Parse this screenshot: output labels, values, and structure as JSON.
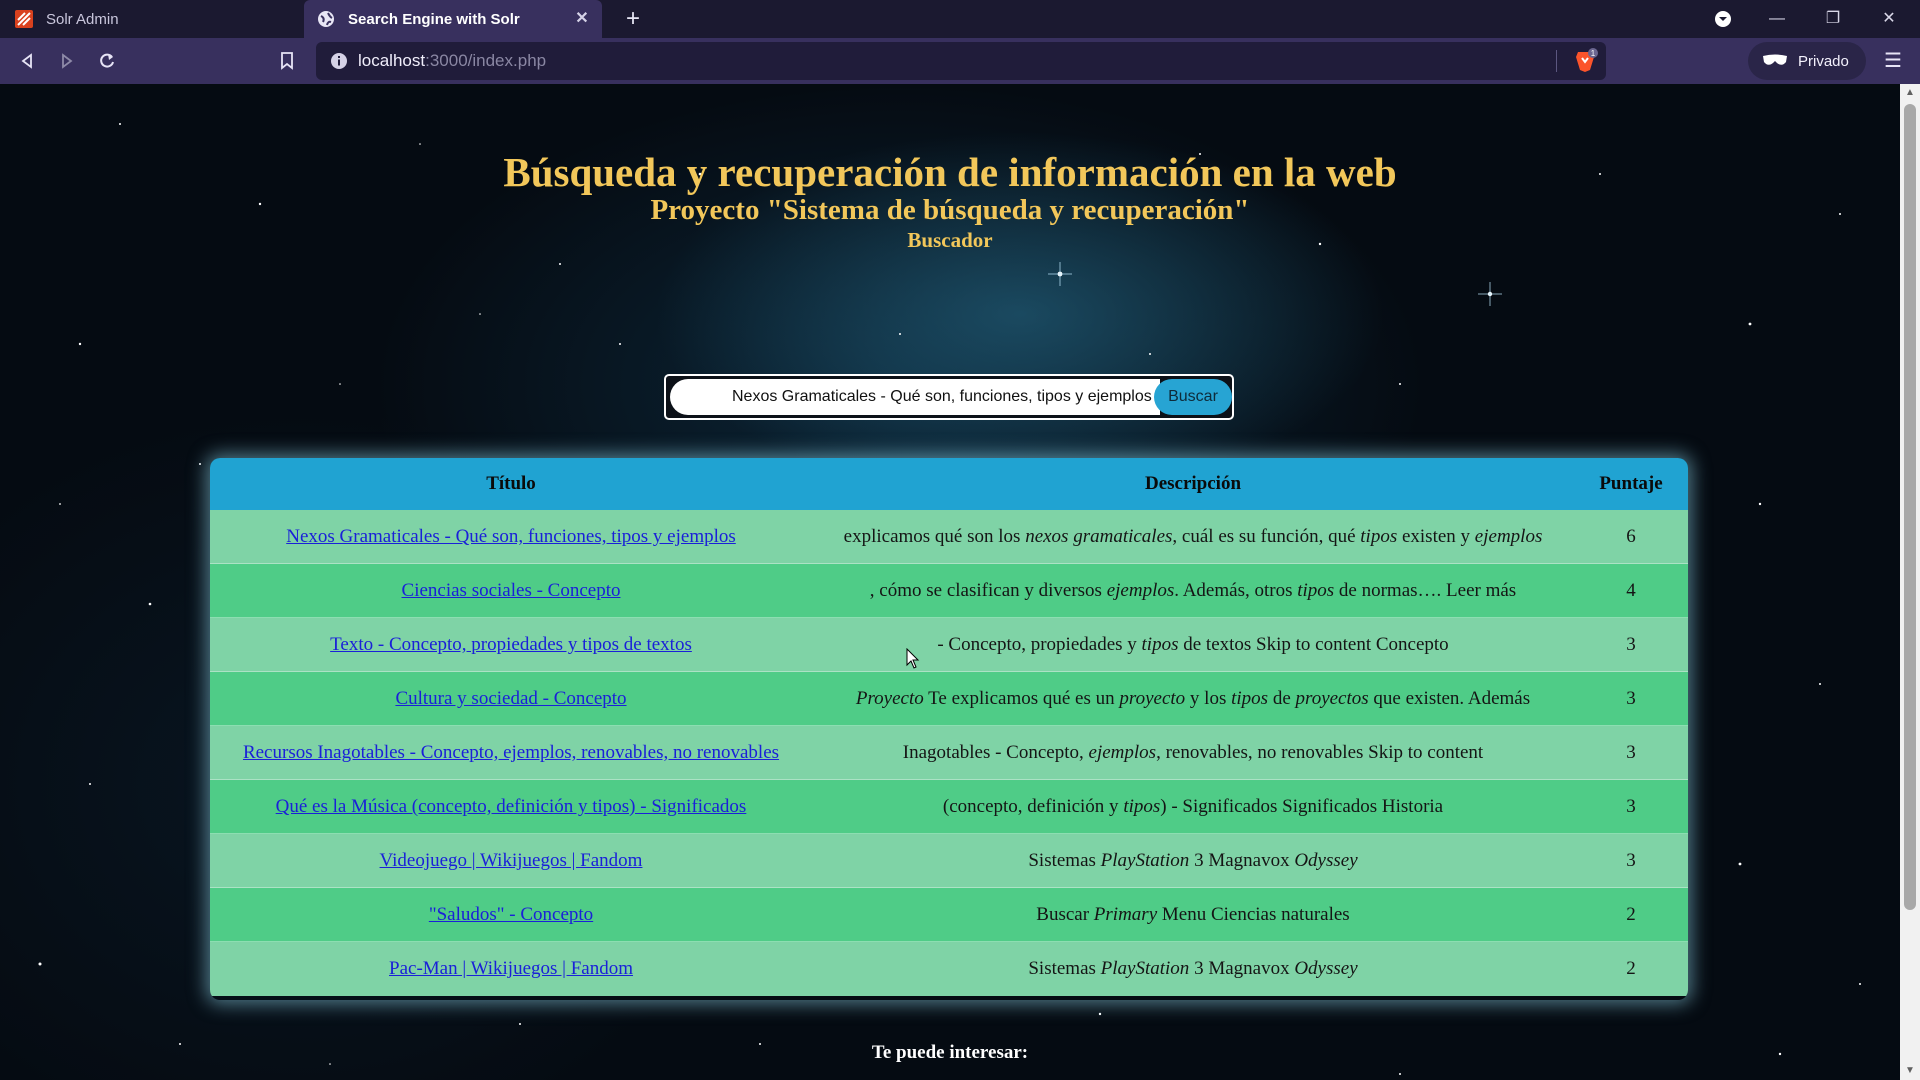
{
  "browser": {
    "tabs": [
      {
        "label": "Solr Admin",
        "active": false
      },
      {
        "label": "Search Engine with Solr",
        "active": true
      }
    ],
    "url_host": "localhost",
    "url_rest": ":3000/index.php",
    "private_label": "Privado",
    "shield_badge": "1"
  },
  "page": {
    "title": "Búsqueda y recuperación de información en la web",
    "subtitle": "Proyecto \"Sistema de búsqueda y recuperación\"",
    "section": "Buscador",
    "search": {
      "value": "Nexos Gramaticales - Qué son, funciones, tipos y ejemplos",
      "button_label": "Buscar"
    },
    "table": {
      "columns": [
        "Título",
        "Descripción",
        "Puntaje"
      ],
      "rows": [
        {
          "title": "Nexos Gramaticales - Qué son, funciones, tipos y ejemplos",
          "desc": "explicamos qué son los <i>nexos gramaticales</i>, cuál es su función, qué <i>tipos</i> existen y <i>ejemplos</i>",
          "score": "6"
        },
        {
          "title": "Ciencias sociales - Concepto",
          "desc": ", cómo se clasifican y diversos <i>ejemplos</i>. Además, otros <i>tipos</i> de normas…. Leer más",
          "score": "4"
        },
        {
          "title": "Texto - Concepto, propiedades y tipos de textos",
          "desc": "- Concepto, propiedades y <i>tipos</i> de textos Skip to content Concepto",
          "score": "3"
        },
        {
          "title": "Cultura y sociedad - Concepto",
          "desc": "<i>Proyecto</i> Te explicamos qué es un <i>proyecto</i> y los <i>tipos</i> de <i>proyectos</i> que existen. Además",
          "score": "3"
        },
        {
          "title": "Recursos Inagotables - Concepto, ejemplos, renovables, no renovables",
          "desc": "Inagotables - Concepto, <i>ejemplos</i>, renovables, no renovables Skip to content",
          "score": "3"
        },
        {
          "title": "Qué es la Música (concepto, definición y tipos) - Significados",
          "desc": "(concepto, definición y <i>tipos</i>) - Significados Significados Historia",
          "score": "3"
        },
        {
          "title": "Videojuego | Wikijuegos | Fandom",
          "desc": "Sistemas <i>PlayStation</i> 3 Magnavox <i>Odyssey</i>",
          "score": "3"
        },
        {
          "title": "\"Saludos\" - Concepto",
          "desc": "Buscar <i>Primary</i> Menu Ciencias naturales",
          "score": "2"
        },
        {
          "title": "Pac-Man | Wikijuegos | Fandom",
          "desc": "Sistemas <i>PlayStation</i> 3 Magnavox <i>Odyssey</i>",
          "score": "2"
        }
      ]
    },
    "footer_text": "Te puede interesar:"
  }
}
